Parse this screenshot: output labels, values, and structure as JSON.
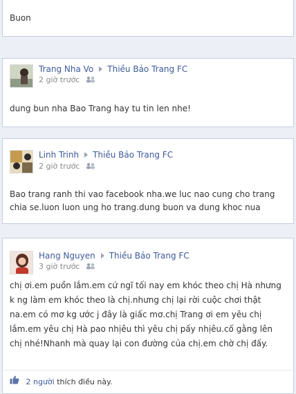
{
  "top_post": {
    "message": "Buon"
  },
  "posts": [
    {
      "author": "Trang Nha Vo",
      "target": "Thiều Bảo Trang FC",
      "time": "2 giờ trước",
      "message": "dung bun nha Bao Trang hay tu tin len nhe!"
    },
    {
      "author": "Linh Trinh",
      "target": "Thiều Bảo Trang FC",
      "time": "2 giờ trước",
      "message_lines": [
        "Bao trang ranh thi vao facebook nha.we luc nao cung cho trang",
        "chia se.luon luon ung ho trang.dung buon va dung khoc nua"
      ]
    },
    {
      "author": "Hang Nguyen",
      "target": "Thiều Bảo Trang FC",
      "time": "3 giờ trước",
      "message_lines": [
        "chị ơi.em puồn lắm.em cứ ngĩ tối nay em khóc theo chị Hà nhưng",
        "k ng làm em khóc theo là chị.nhưng chị lại rời cuộc chơi thật",
        "na.em có mơ kg ước j đây là giấc mơ.chị Trang ơi em yêu chị",
        "lắm.em yêu chị Hà pao nhịêu thì yêu chị pấy nhịêu.cố gằng lên",
        "chị nhé!Nhanh mà quay lại con đường của chị.em chờ chị đấy."
      ],
      "likes": {
        "count": "2 người",
        "text": "thích điều này."
      }
    }
  ],
  "colors": {
    "link": "#3b5998",
    "background": "#eceff5",
    "border": "#c4cde0"
  },
  "icons": {
    "arrow": "triangle-right",
    "audience": "people-icon",
    "like": "thumbs-up-icon"
  }
}
